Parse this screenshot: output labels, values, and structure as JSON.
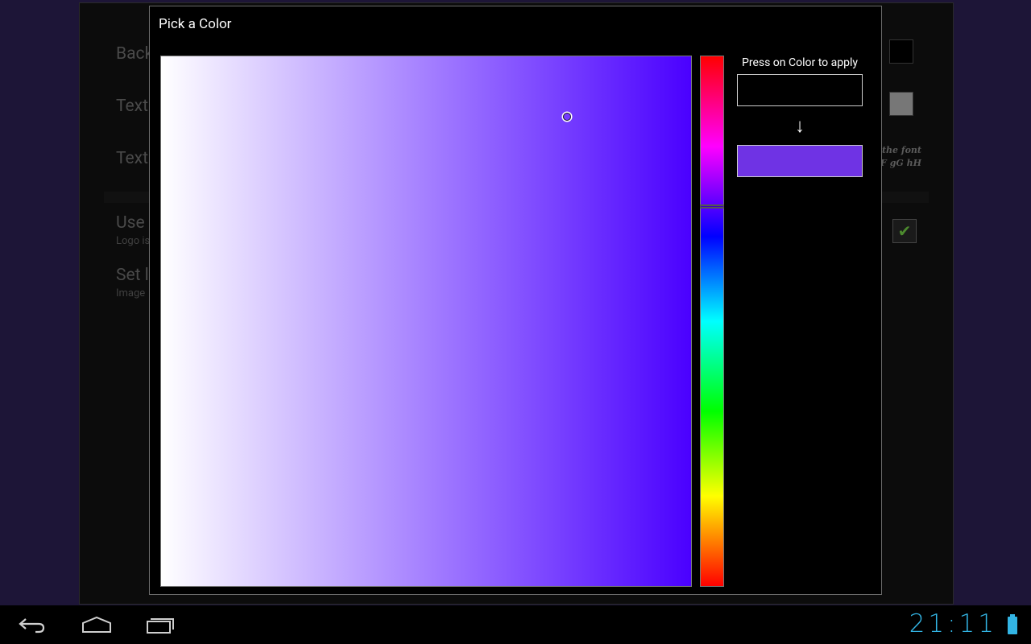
{
  "background_screen": {
    "rows": [
      {
        "title": "Background Color",
        "subtitle": ""
      },
      {
        "title": "Text",
        "subtitle": ""
      },
      {
        "title": "Text",
        "subtitle": ""
      },
      {
        "title": "Use",
        "subtitle": "Logo is"
      },
      {
        "title": "Set l",
        "subtitle": "Image"
      }
    ],
    "font_preview": [
      "of the font",
      "E fF gG hH"
    ],
    "background_swatch_color": "#000000",
    "text_swatch_color": "#777777",
    "checkbox_checked": true
  },
  "dialog": {
    "title": "Pick a Color",
    "apply_label": "Press on Color to apply",
    "arrow": "↓",
    "old_color": "#000000",
    "new_color": "#6f33e4",
    "hue_color": "#4a00ff"
  },
  "status": {
    "time": "21:11"
  },
  "icons": {
    "back": "back-icon",
    "home": "home-icon",
    "recents": "recent-apps-icon",
    "battery": "battery-icon"
  }
}
